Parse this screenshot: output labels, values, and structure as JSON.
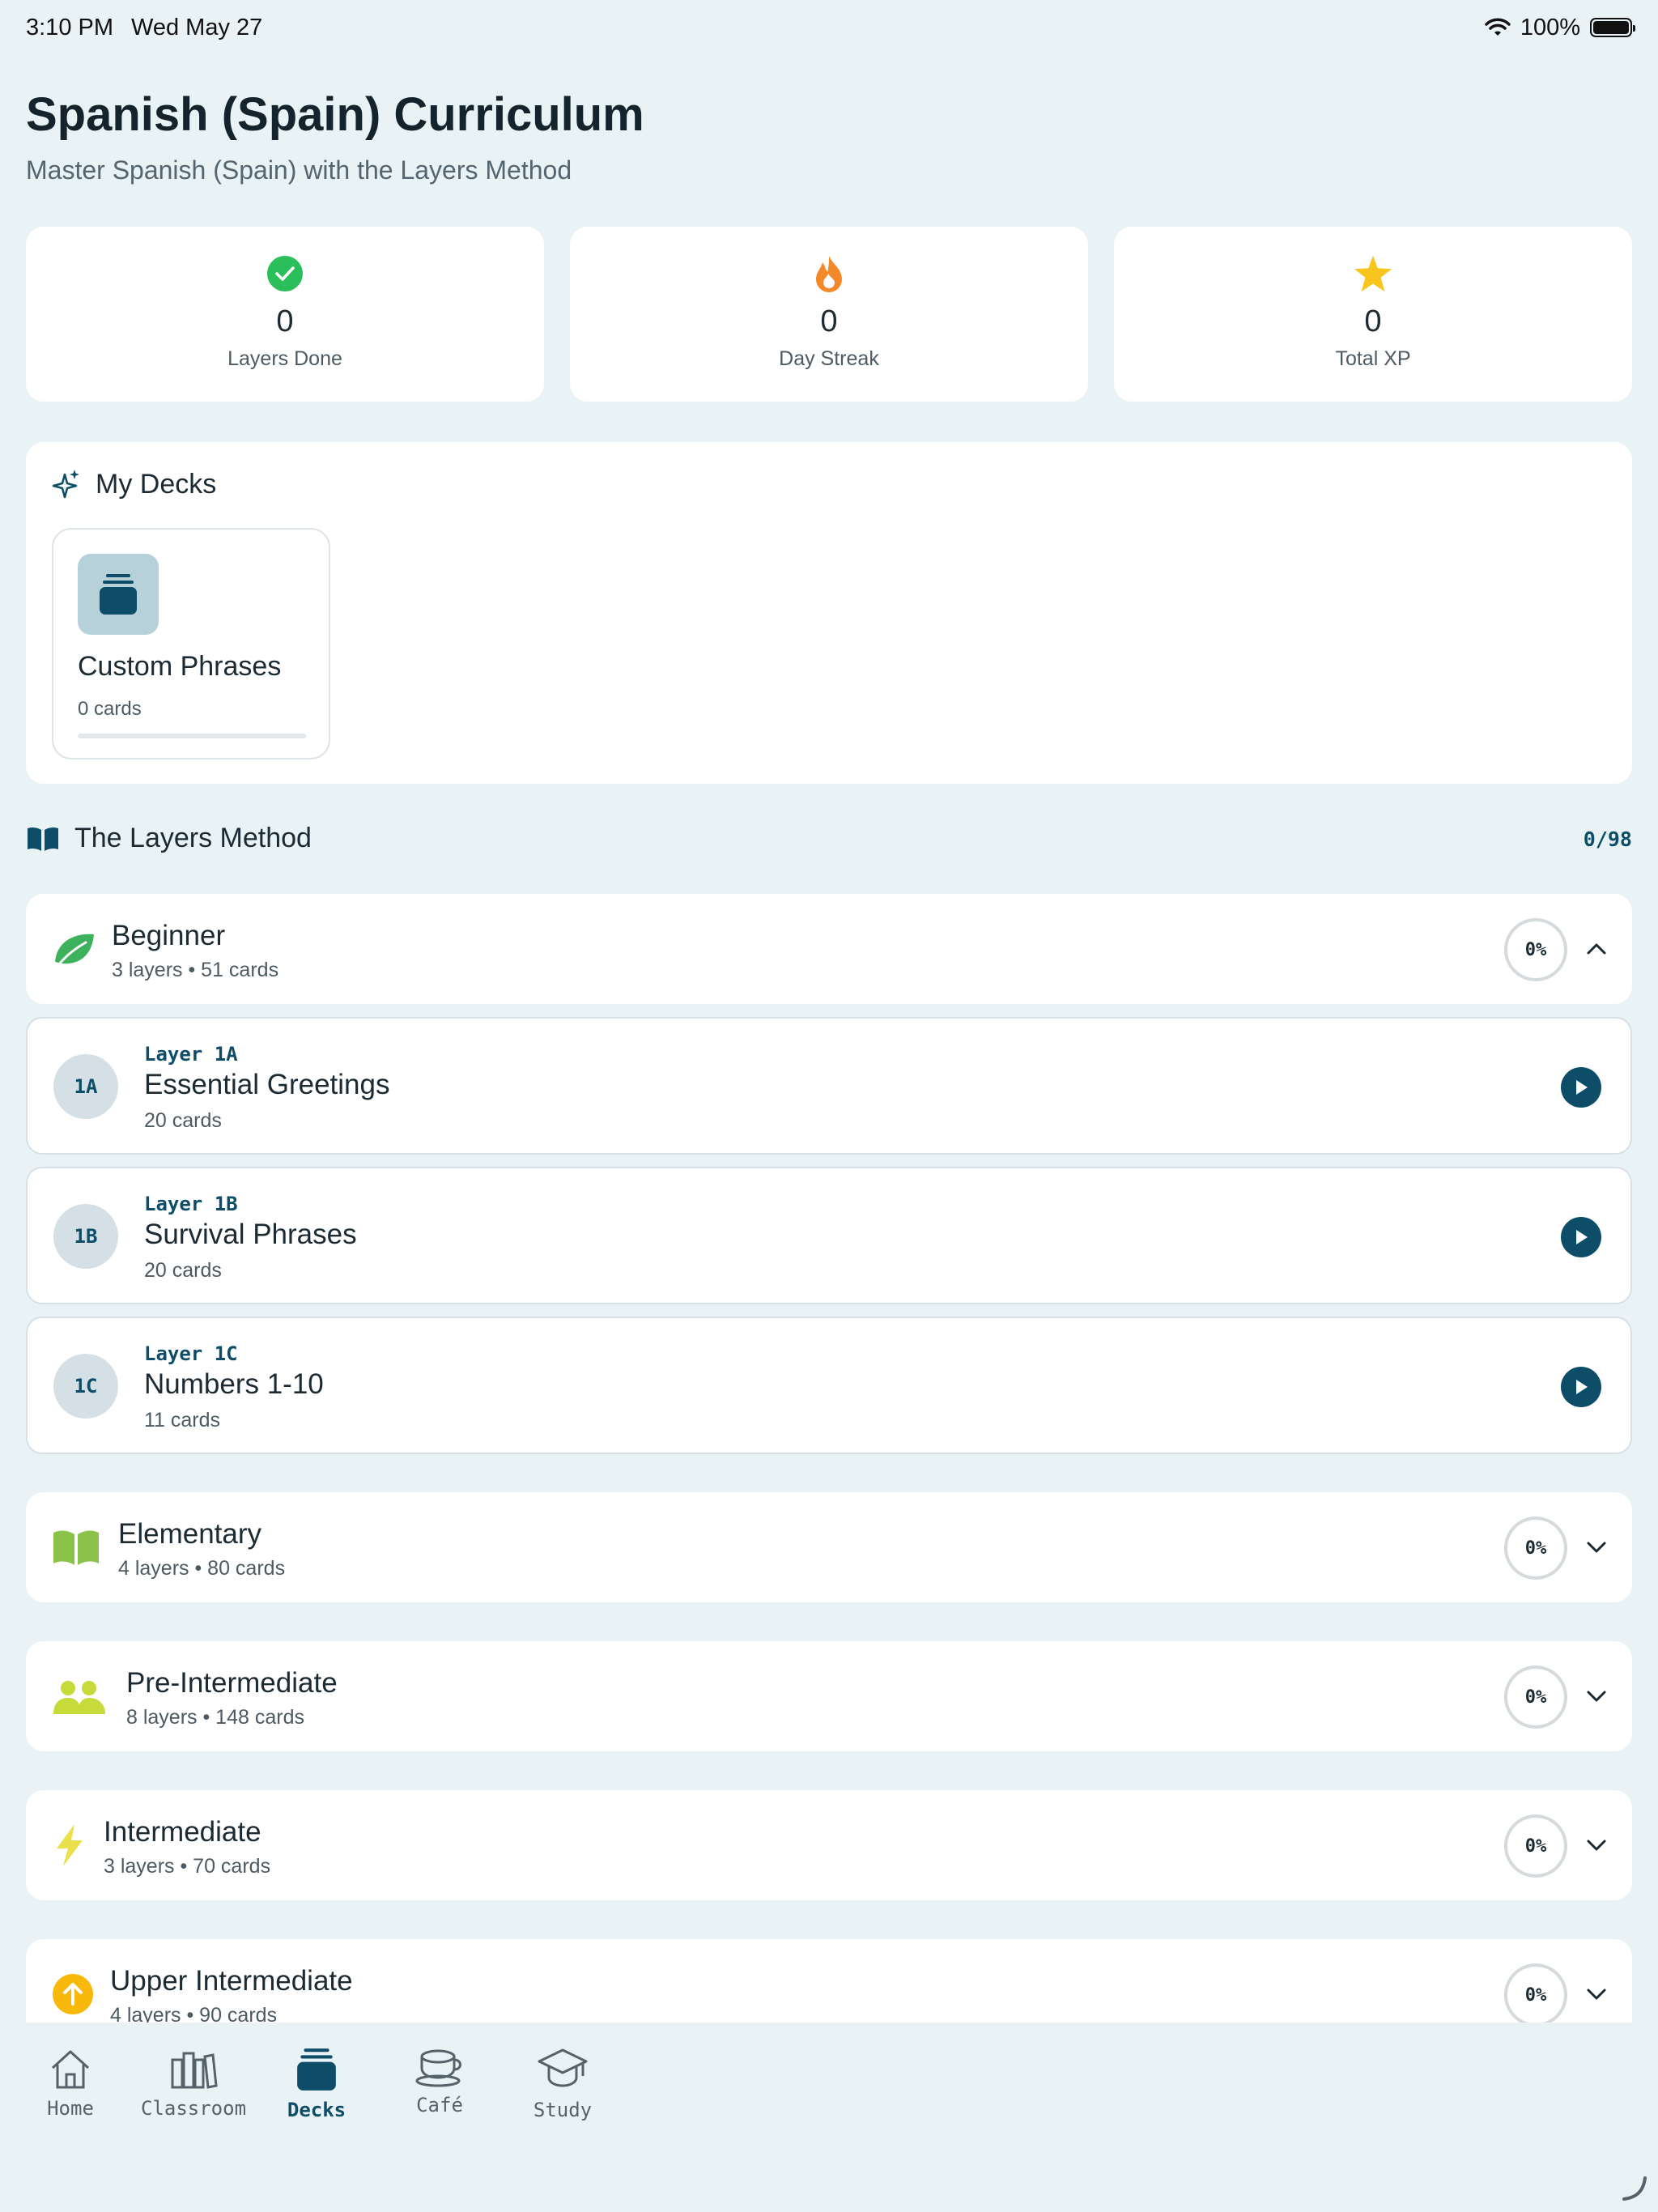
{
  "status_bar": {
    "time": "3:10 PM",
    "date": "Wed May 27",
    "battery": "100%"
  },
  "header": {
    "title": "Spanish (Spain) Curriculum",
    "subtitle": "Master Spanish (Spain) with the Layers Method"
  },
  "stats": [
    {
      "icon": "check-circle-icon",
      "value": "0",
      "label": "Layers Done"
    },
    {
      "icon": "flame-icon",
      "value": "0",
      "label": "Day Streak"
    },
    {
      "icon": "star-icon",
      "value": "0",
      "label": "Total XP"
    }
  ],
  "my_decks": {
    "title": "My Decks",
    "icon": "sparkle-icon",
    "decks": [
      {
        "name": "Custom Phrases",
        "count": "0 cards",
        "progress": 0
      }
    ]
  },
  "layers_method": {
    "title": "The Layers Method",
    "icon": "open-book-icon",
    "progress": "0/98",
    "levels": [
      {
        "name": "Beginner",
        "meta": "3 layers • 51 cards",
        "percent": "0%",
        "expanded": true,
        "icon": "leaf-icon",
        "layers": [
          {
            "badge": "1A",
            "tag": "Layer 1A",
            "title": "Essential Greetings",
            "cards": "20 cards"
          },
          {
            "badge": "1B",
            "tag": "Layer 1B",
            "title": "Survival Phrases",
            "cards": "20 cards"
          },
          {
            "badge": "1C",
            "tag": "Layer 1C",
            "title": "Numbers 1-10",
            "cards": "11 cards"
          }
        ]
      },
      {
        "name": "Elementary",
        "meta": "4 layers • 80 cards",
        "percent": "0%",
        "expanded": false,
        "icon": "book-icon"
      },
      {
        "name": "Pre-Intermediate",
        "meta": "8 layers • 148 cards",
        "percent": "0%",
        "expanded": false,
        "icon": "people-icon"
      },
      {
        "name": "Intermediate",
        "meta": "3 layers • 70 cards",
        "percent": "0%",
        "expanded": false,
        "icon": "bolt-icon"
      },
      {
        "name": "Upper Intermediate",
        "meta": "4 layers • 90 cards",
        "percent": "0%",
        "expanded": false,
        "icon": "arrow-up-circle-icon"
      }
    ]
  },
  "tab_bar": {
    "active": "Decks",
    "tabs": [
      {
        "label": "Home",
        "icon": "home-icon"
      },
      {
        "label": "Classroom",
        "icon": "books-icon"
      },
      {
        "label": "Decks",
        "icon": "deck-stack-icon"
      },
      {
        "label": "Café",
        "icon": "coffee-cup-icon"
      },
      {
        "label": "Study",
        "icon": "graduation-cap-icon"
      }
    ]
  },
  "colors": {
    "accent": "#0d4d68",
    "background": "#e9f3f6",
    "check_green": "#2bbf5b",
    "flame_orange": "#f5892a",
    "star_yellow": "#f7c51e",
    "leaf_green": "#3db15c",
    "book_green": "#8bc34a",
    "people_lime": "#c6da3a",
    "bolt_yellow": "#e9e14a",
    "arrow_amber": "#f8b90c"
  }
}
